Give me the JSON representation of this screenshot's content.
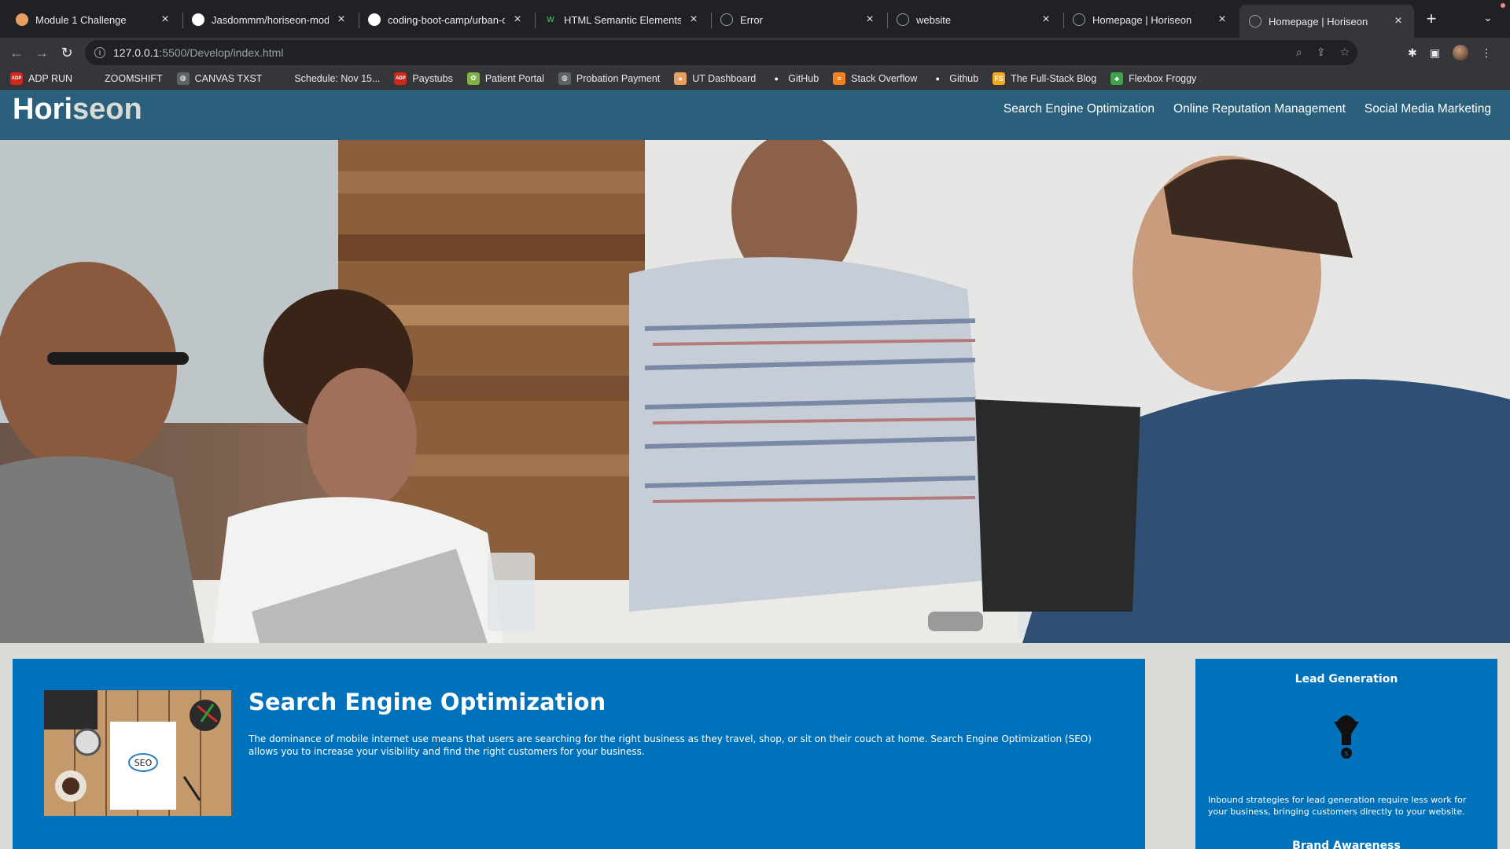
{
  "tabs": [
    {
      "label": "Module 1 Challenge",
      "icon": "orange-circle-icon"
    },
    {
      "label": "Jasdommm/horiseon-module",
      "icon": "github-icon"
    },
    {
      "label": "coding-boot-camp/urban-o",
      "icon": "github-icon"
    },
    {
      "label": "HTML Semantic Elements",
      "icon": "w3schools-icon"
    },
    {
      "label": "Error",
      "icon": "globe-icon"
    },
    {
      "label": "website",
      "icon": "globe-icon"
    },
    {
      "label": "Homepage | Horiseon",
      "icon": "globe-icon"
    },
    {
      "label": "Homepage | Horiseon",
      "icon": "globe-icon",
      "active": true
    }
  ],
  "toolbar": {
    "url_host": "127.0.0.1",
    "url_path": ":5500/Develop/index.html"
  },
  "bookmarks": [
    {
      "label": "ADP RUN",
      "icon": "adp-icon",
      "color": "#d0271d"
    },
    {
      "label": "ZOOMSHIFT",
      "icon": "blank-icon",
      "color": "#35363a"
    },
    {
      "label": "CANVAS TXST",
      "icon": "globe-icon",
      "color": "#5f6368"
    },
    {
      "label": "Schedule: Nov 15...",
      "icon": "blank-icon",
      "color": "#35363a"
    },
    {
      "label": "Paystubs",
      "icon": "adp-icon",
      "color": "#d0271d"
    },
    {
      "label": "Patient Portal",
      "icon": "leaf-icon",
      "color": "#7cb342"
    },
    {
      "label": "Probation Payment",
      "icon": "globe-icon",
      "color": "#5f6368"
    },
    {
      "label": "UT Dashboard",
      "icon": "orange-circle-icon",
      "color": "#e8a060"
    },
    {
      "label": "GitHub",
      "icon": "github-icon",
      "color": "#35363a"
    },
    {
      "label": "Stack Overflow",
      "icon": "stackoverflow-icon",
      "color": "#f48024"
    },
    {
      "label": "Github",
      "icon": "github-icon",
      "color": "#35363a"
    },
    {
      "label": "The Full-Stack Blog",
      "icon": "fs-icon",
      "color": "#f5a623"
    },
    {
      "label": "Flexbox Froggy",
      "icon": "frog-icon",
      "color": "#3fa34d"
    }
  ],
  "site": {
    "logo_main": "Hori",
    "logo_accent": "seon",
    "nav": [
      "Search Engine Optimization",
      "Online Reputation Management",
      "Social Media Marketing"
    ],
    "colors": {
      "header": "#2a607c",
      "panel": "#0072bb",
      "background": "#d9dcd6"
    }
  },
  "content": {
    "title": "Search Engine Optimization",
    "body": "The dominance of mobile internet use means that users are searching for the right business as they travel, shop, or sit on their couch at home. Search Engine Optimization (SEO) allows you to increase your visibility and find the right customers for your business."
  },
  "benefits": {
    "title": "Lead Generation",
    "body": "Inbound strategies for lead generation require less work for your business, bringing customers directly to your website.",
    "next_title": "Brand Awareness"
  }
}
